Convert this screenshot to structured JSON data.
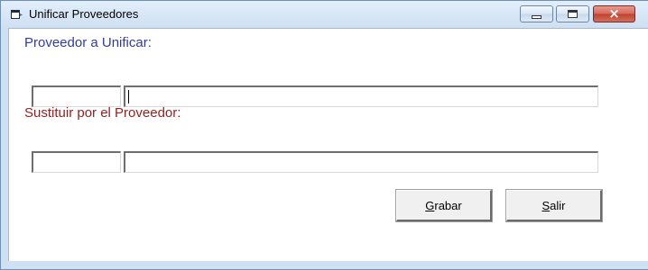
{
  "window": {
    "title": "Unificar Proveedores",
    "icon": "app-window-icon",
    "controls": {
      "minimize": "minimize-icon",
      "maximize": "maximize-icon",
      "close": "×"
    }
  },
  "form": {
    "provider_label": "Proveedor a Unificar:",
    "replace_label": "Sustituir por el Proveedor:",
    "provider_code": "",
    "provider_name": "",
    "replace_code": "",
    "replace_name": ""
  },
  "buttons": {
    "save_mnemonic": "G",
    "save_rest": "rabar",
    "exit_mnemonic": "S",
    "exit_rest": "alir"
  },
  "colors": {
    "provider_label": "#2f3ab0",
    "replace_label": "#9a1d1d",
    "frame": "#cfe0f2",
    "close_button": "#c2402f"
  }
}
